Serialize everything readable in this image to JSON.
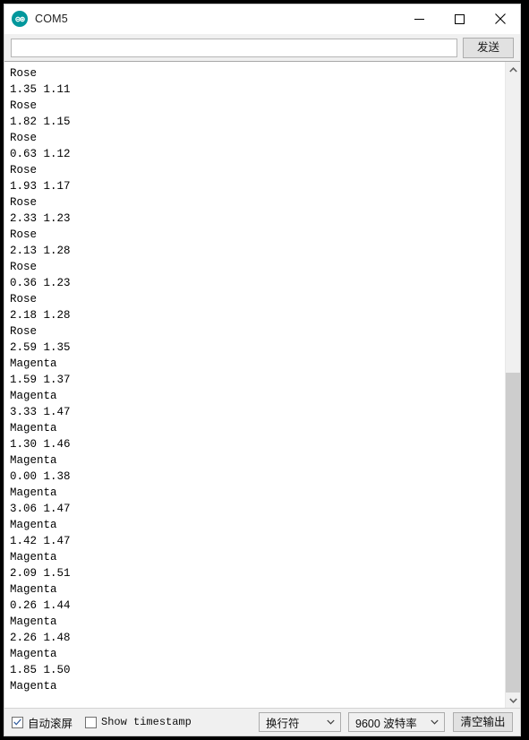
{
  "window": {
    "title": "COM5",
    "app_icon": "arduino-infinity-icon",
    "accent_color": "#00979c",
    "controls": {
      "minimize": "minimize-icon",
      "maximize": "maximize-icon",
      "close": "close-icon"
    }
  },
  "send_bar": {
    "input_value": "",
    "input_placeholder": "",
    "send_label": "发送"
  },
  "output": {
    "lines": [
      "Rose",
      "1.35 1.11",
      "Rose",
      "1.82 1.15",
      "Rose",
      "0.63 1.12",
      "Rose",
      "1.93 1.17",
      "Rose",
      "2.33 1.23",
      "Rose",
      "2.13 1.28",
      "Rose",
      "0.36 1.23",
      "Rose",
      "2.18 1.28",
      "Rose",
      "2.59 1.35",
      "Magenta",
      "1.59 1.37",
      "Magenta",
      "3.33 1.47",
      "Magenta",
      "1.30 1.46",
      "Magenta",
      "0.00 1.38",
      "Magenta",
      "3.06 1.47",
      "Magenta",
      "1.42 1.47",
      "Magenta",
      "2.09 1.51",
      "Magenta",
      "0.26 1.44",
      "Magenta",
      "2.26 1.48",
      "Magenta",
      "1.85 1.50",
      "Magenta"
    ]
  },
  "scrollbar": {
    "up_arrow": "chevron-up-icon",
    "down_arrow": "chevron-down-icon",
    "thumb_top_percent": 48
  },
  "bottom_bar": {
    "autoscroll": {
      "label": "自动滚屏",
      "checked": true
    },
    "timestamp": {
      "label": "Show timestamp",
      "checked": false
    },
    "line_ending": {
      "selected": "换行符",
      "arrow": "chevron-down-icon"
    },
    "baud_rate": {
      "selected": "9600 波特率",
      "arrow": "chevron-down-icon"
    },
    "clear_label": "清空输出"
  }
}
